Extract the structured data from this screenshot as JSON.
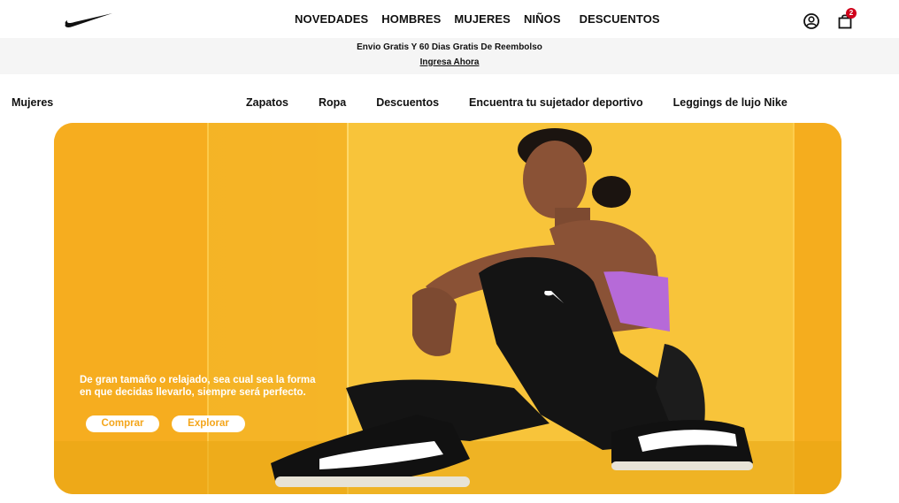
{
  "header": {
    "logo": "nike-swoosh",
    "nav": [
      "NOVEDADES",
      "HOMBRES",
      "MUJERES",
      "NIÑOS",
      "DESCUENTOS"
    ],
    "icons": [
      "user-icon",
      "bag-icon"
    ],
    "cart_count": "2"
  },
  "promo": {
    "text": "Envio Gratis Y 60 Dias Gratis De Reembolso",
    "link": "Ingresa Ahora"
  },
  "subnav": {
    "title": "Mujeres",
    "items": [
      "Zapatos",
      "Ropa",
      "Descuentos",
      "Encuentra tu sujetador deportivo",
      "Leggings de lujo Nike"
    ]
  },
  "hero": {
    "copy_line1": "De gran tamaño o relajado, sea cual sea la forma",
    "copy_line2": "en que decidas llevarlo, siempre será perfecto.",
    "primary_button": "Comprar",
    "secondary_button": "Explorar",
    "background_color": "#f7b726",
    "accent_color": "#f4a61c"
  },
  "colors": {
    "badge": "#d0021b",
    "text": "#111111",
    "promo_bg": "#f5f5f5"
  }
}
